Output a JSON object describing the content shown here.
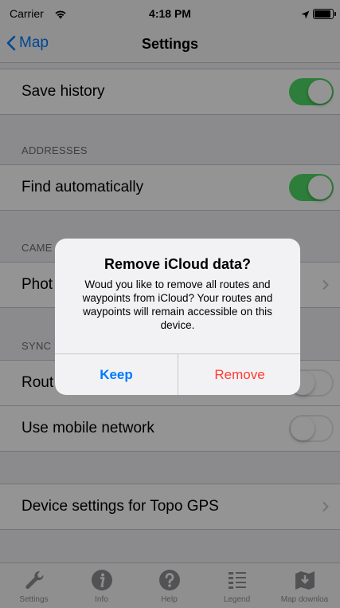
{
  "status_bar": {
    "carrier": "Carrier",
    "time": "4:18 PM",
    "icons": [
      "wifi-icon",
      "location-arrow-icon",
      "battery-icon"
    ]
  },
  "nav": {
    "back_label": "Map",
    "title": "Settings"
  },
  "settings": {
    "save_history": {
      "label": "Save history",
      "on": true
    },
    "addresses_header": "ADDRESSES",
    "find_automatically": {
      "label": "Find automatically",
      "on": true
    },
    "camera_header": "CAME",
    "photo_row": {
      "label": "Phot"
    },
    "sync_header": "SYNC",
    "routes_row": {
      "label": "Rout",
      "on": false
    },
    "mobile_network": {
      "label": "Use mobile network",
      "on": false
    },
    "device_settings": {
      "label": "Device settings for Topo GPS"
    }
  },
  "tab_bar": {
    "tabs": [
      {
        "label": "Settings",
        "icon": "wrench-icon"
      },
      {
        "label": "Info",
        "icon": "info-icon"
      },
      {
        "label": "Help",
        "icon": "help-icon"
      },
      {
        "label": "Legend",
        "icon": "legend-icon"
      },
      {
        "label": "Map downloa",
        "icon": "map-download-icon"
      }
    ]
  },
  "alert": {
    "title": "Remove iCloud data?",
    "message": "Woud you like to remove all routes and waypoints from iCloud? Your routes and waypoints will remain accessible on this device.",
    "keep_label": "Keep",
    "remove_label": "Remove"
  },
  "colors": {
    "accent": "#007aff",
    "toggle_on": "#4cd964",
    "destructive": "#ff3b30"
  }
}
